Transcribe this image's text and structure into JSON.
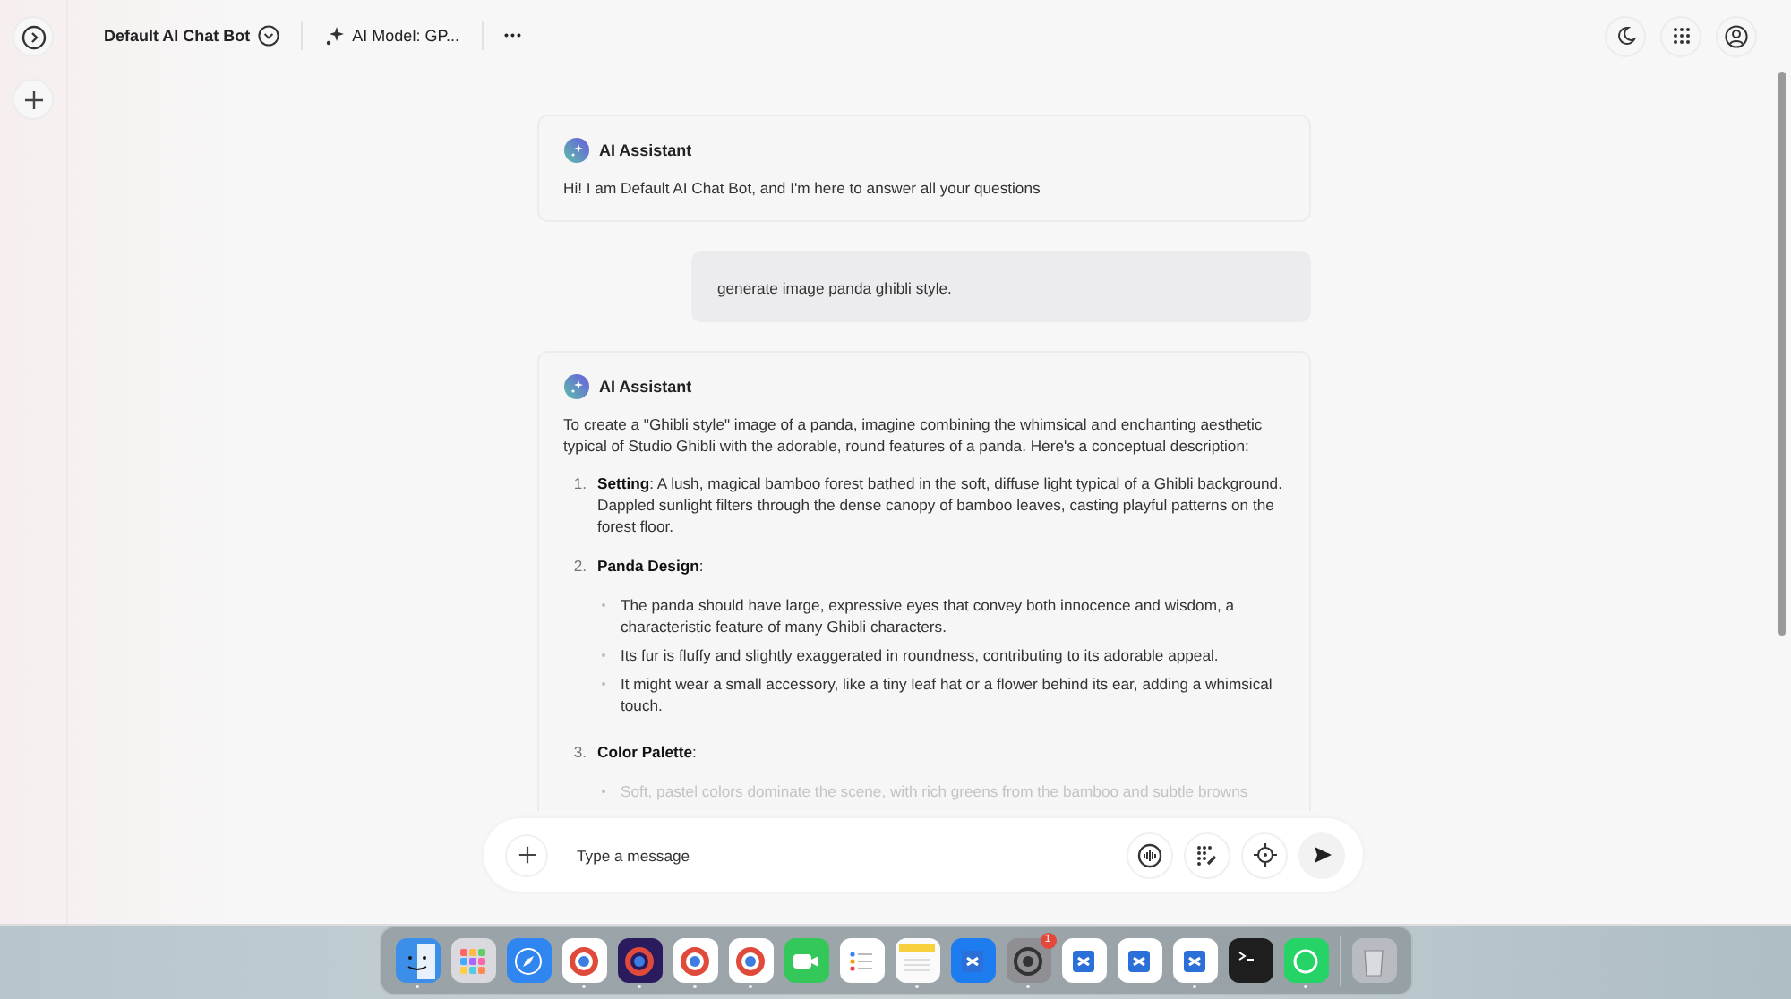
{
  "header": {
    "bot_name": "Default AI Chat Bot",
    "model": "AI Model: GP...",
    "more": "•••"
  },
  "messages": [
    {
      "kind": "assistant",
      "author": "AI Assistant",
      "text": "Hi! I am Default AI Chat Bot, and I'm here to answer all your questions"
    },
    {
      "kind": "user",
      "text": "generate image panda ghibli style."
    },
    {
      "kind": "assistant",
      "author": "AI Assistant",
      "text": "To create a \"Ghibli style\" image of a panda, imagine combining the whimsical and enchanting aesthetic typical of Studio Ghibli with the adorable, round features of a panda. Here's a conceptual description:",
      "list": [
        {
          "number": "1.",
          "text": "**Setting**: A lush, magical bamboo forest bathed in the soft, diffuse light typical of a Ghibli background. Dappled sunlight filters through the dense canopy of bamboo leaves, casting playful patterns on the forest floor."
        },
        {
          "number": "2.",
          "text": "**Panda Design**:",
          "bullets": [
            "The panda should have large, expressive eyes that convey both innocence and wisdom, a characteristic feature of many Ghibli characters.",
            "Its fur is fluffy and slightly exaggerated in roundness, contributing to its adorable appeal.",
            "It might wear a small accessory, like a tiny leaf hat or a flower behind its ear, adding a whimsical touch."
          ]
        },
        {
          "number": "3.",
          "text": "**Color Palette**:",
          "bullets": [
            "Soft, pastel colors dominate the scene, with rich greens from the bamboo and subtle browns"
          ],
          "faded": true
        }
      ]
    }
  ],
  "composer": {
    "placeholder": "Type a message"
  },
  "dock": [
    {
      "kind": "finder",
      "color": "#3b8fe8",
      "running": true
    },
    {
      "kind": "grid",
      "color": "#d9d9de",
      "running": false
    },
    {
      "kind": "compass",
      "color": "#2f86f0",
      "running": false
    },
    {
      "kind": "ring",
      "color": "#ffffff",
      "running": true
    },
    {
      "kind": "ring",
      "color": "#2a1a5e",
      "running": true
    },
    {
      "kind": "ring",
      "color": "#ffffff",
      "running": true
    },
    {
      "kind": "ring",
      "color": "#ffffff",
      "running": true
    },
    {
      "kind": "camera",
      "color": "#34c759",
      "running": false
    },
    {
      "kind": "list",
      "color": "#ffffff",
      "running": false
    },
    {
      "kind": "notes",
      "color": "#fafafa",
      "running": true
    },
    {
      "kind": "letter",
      "color": "#1c7cf0",
      "running": false
    },
    {
      "kind": "gear",
      "color": "#8e8e93",
      "running": true,
      "badge": "1"
    },
    {
      "kind": "letter",
      "color": "#ffffff",
      "running": false
    },
    {
      "kind": "letter",
      "color": "#ffffff",
      "running": false
    },
    {
      "kind": "letter",
      "color": "#ffffff",
      "running": true
    },
    {
      "kind": "terminal",
      "color": "#1e1e1e",
      "running": false
    },
    {
      "kind": "bubble",
      "color": "#25d366",
      "running": true
    },
    {
      "kind": "trash",
      "color": "#b8bcc2",
      "running": false
    }
  ]
}
